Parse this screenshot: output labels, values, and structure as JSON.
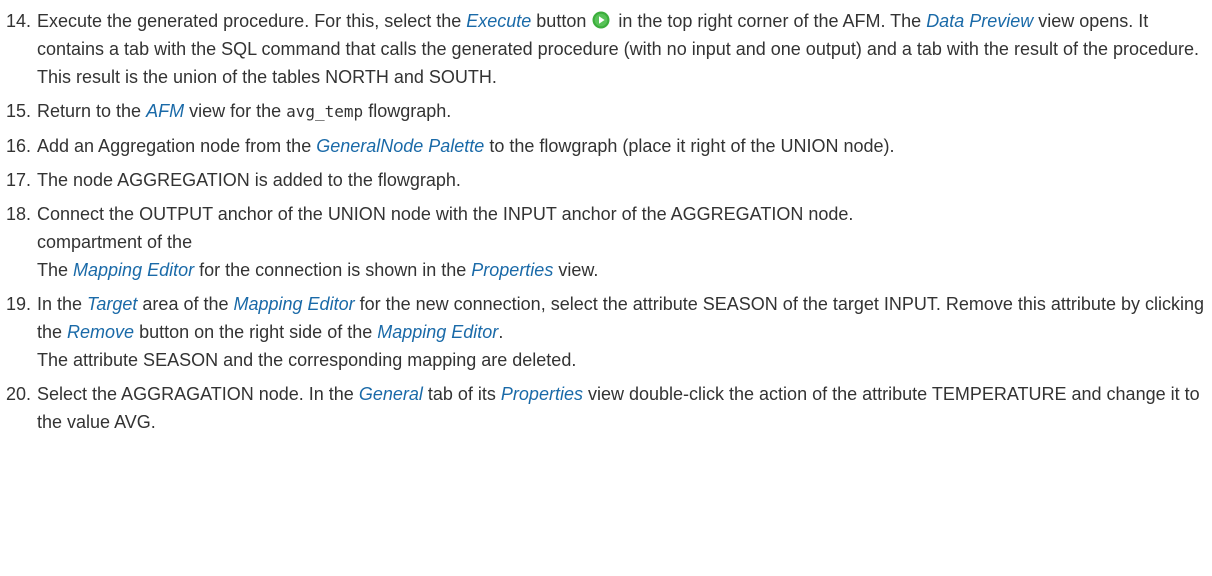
{
  "steps": [
    {
      "num": "14.",
      "p1": "Execute the generated procedure. For this, select the ",
      "em1": "Execute",
      "p2": " button ",
      "icon": "execute-play-icon",
      "p3": " in the top right corner of the AFM. The ",
      "em2": "Data Preview",
      "p4": " view opens. It contains a tab with the SQL command that calls the generated procedure (with no input and one output) and a tab with the result of the procedure. This result is the union of the tables NORTH and SOUTH."
    },
    {
      "num": "15.",
      "p1": "Return to the ",
      "em1": "AFM",
      "p2": " view for the ",
      "code": "avg_temp",
      "p3": " flowgraph."
    },
    {
      "num": "16.",
      "p1": "Add an Aggregation node from the ",
      "em1": "GeneralNode Palette",
      "p2": " to the flowgraph (place it right of the UNION node)."
    },
    {
      "num": "17.",
      "p1": "The node AGGREGATION is added to the flowgraph."
    },
    {
      "num": "18.",
      "p1": "Connect the OUTPUT anchor of the UNION node with the INPUT anchor of the AGGREGATION node.",
      "line2": "compartment of the",
      "p3": "The ",
      "em1": "Mapping Editor",
      "p4": " for the connection is shown in the ",
      "em2": "Properties",
      "p5": " view."
    },
    {
      "num": "19.",
      "p1": "In the ",
      "em1": "Target",
      "p2": " area of the ",
      "em2": "Mapping Editor",
      "p3": " for the new connection, select the attribute SEASON of the target INPUT. Remove this attribute by clicking the ",
      "em3": "Remove",
      "p4": " button on the right side of the ",
      "em4": "Mapping Editor",
      "p5": ".",
      "line3": "The attribute SEASON and the corresponding mapping are deleted."
    },
    {
      "num": "20.",
      "p1": "Select the AGGRAGATION node. In the ",
      "em1": "General",
      "p2": " tab of its ",
      "em2": "Properties",
      "p3": " view double-click the action of the attribute TEMPERATURE and change it to the value AVG."
    }
  ],
  "colors": {
    "text": "#333333",
    "emphasis": "#1a6aa8",
    "icon_green": "#3cae3c"
  }
}
